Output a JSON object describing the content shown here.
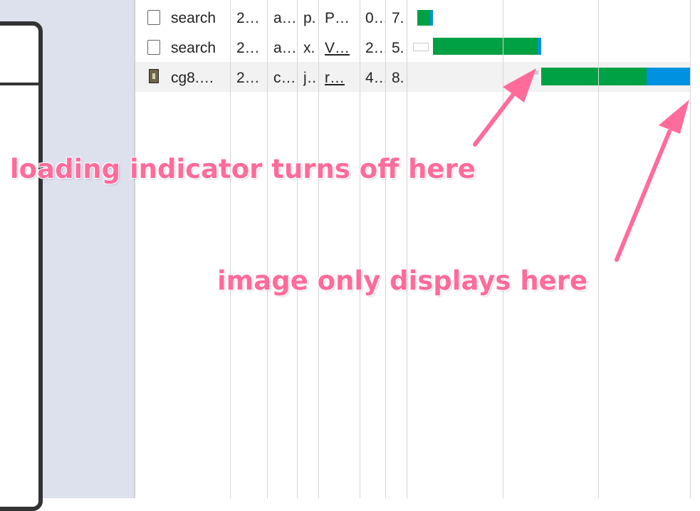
{
  "requests": [
    {
      "name": "search",
      "col2": "2…",
      "col3": "a…",
      "col4": "p.",
      "col5": "P…",
      "col6": "0…",
      "col7": "7.",
      "icon": "document-icon",
      "underline": false
    },
    {
      "name": "search",
      "col2": "2…",
      "col3": "a…",
      "col4": "x.",
      "col5": "V…",
      "col6": "2…",
      "col7": "5.",
      "icon": "document-icon",
      "underline": true
    },
    {
      "name": "cg8.…",
      "col2": "2…",
      "col3": "c…",
      "col4": "j…",
      "col5": "r…",
      "col6": "4…",
      "col7": "8.",
      "icon": "image-thumbnail-icon",
      "underline": true
    }
  ],
  "annotations": {
    "loading": "loading indicator turns off here",
    "image": "image only displays here"
  },
  "colors": {
    "waiting": "#00a144",
    "receiving": "#0092e0",
    "annotation": "#ff6b9a"
  }
}
